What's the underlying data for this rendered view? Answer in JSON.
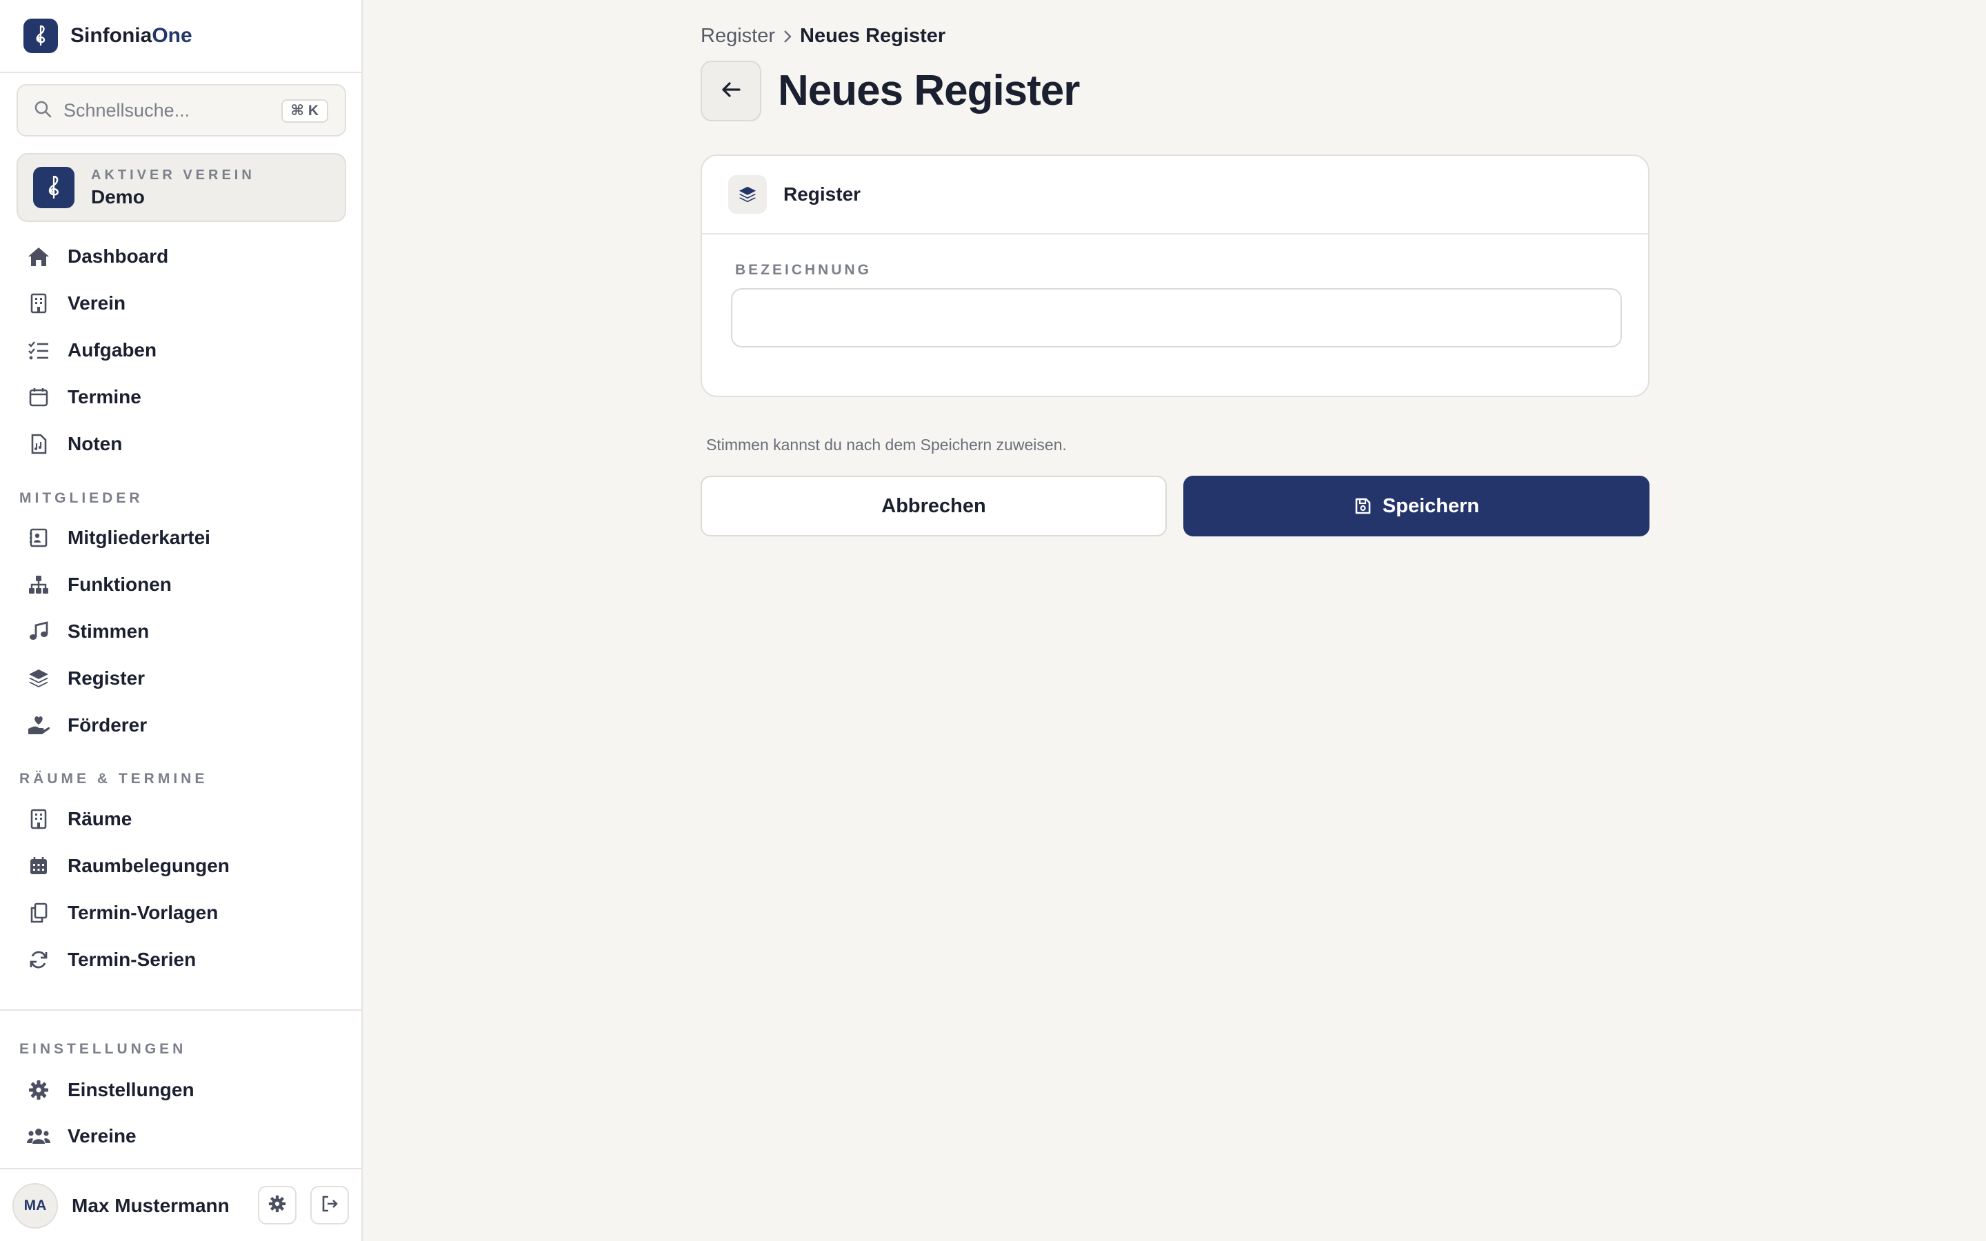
{
  "app": {
    "name_primary": "Sinfonia",
    "name_accent": "One"
  },
  "search": {
    "placeholder": "Schnellsuche...",
    "shortcut": "⌘ K"
  },
  "active_club": {
    "label": "AKTIVER VEREIN",
    "name": "Demo"
  },
  "nav": {
    "main": [
      {
        "label": "Dashboard",
        "icon": "home-icon"
      },
      {
        "label": "Verein",
        "icon": "building-icon"
      },
      {
        "label": "Aufgaben",
        "icon": "task-list-icon"
      },
      {
        "label": "Termine",
        "icon": "calendar-icon"
      },
      {
        "label": "Noten",
        "icon": "sheet-music-file-icon"
      }
    ],
    "members_section": "MITGLIEDER",
    "members": [
      {
        "label": "Mitgliederkartei",
        "icon": "contact-card-icon"
      },
      {
        "label": "Funktionen",
        "icon": "org-chart-icon"
      },
      {
        "label": "Stimmen",
        "icon": "music-note-icon"
      },
      {
        "label": "Register",
        "icon": "layers-icon"
      },
      {
        "label": "Förderer",
        "icon": "hand-heart-icon"
      }
    ],
    "rooms_section": "RÄUME & TERMINE",
    "rooms": [
      {
        "label": "Räume",
        "icon": "building-icon"
      },
      {
        "label": "Raumbelegungen",
        "icon": "calendar-grid-icon"
      },
      {
        "label": "Termin-Vorlagen",
        "icon": "copy-icon"
      },
      {
        "label": "Termin-Serien",
        "icon": "refresh-icon"
      }
    ],
    "settings_section": "EINSTELLUNGEN",
    "settings": [
      {
        "label": "Einstellungen",
        "icon": "gear-icon"
      },
      {
        "label": "Vereine",
        "icon": "users-icon"
      }
    ]
  },
  "user": {
    "initials": "MA",
    "name": "Max Mustermann"
  },
  "breadcrumb": {
    "parent": "Register",
    "current": "Neues Register"
  },
  "page": {
    "title": "Neues Register"
  },
  "card": {
    "title": "Register",
    "field_label": "BEZEICHNUNG",
    "field_value": ""
  },
  "hint": "Stimmen kannst du nach dem Speichern zuweisen.",
  "actions": {
    "cancel": "Abbrechen",
    "save": "Speichern"
  },
  "colors": {
    "primary": "#24356b",
    "background": "#f6f5f2",
    "text": "#1b2030",
    "muted": "#7b7f8a"
  }
}
